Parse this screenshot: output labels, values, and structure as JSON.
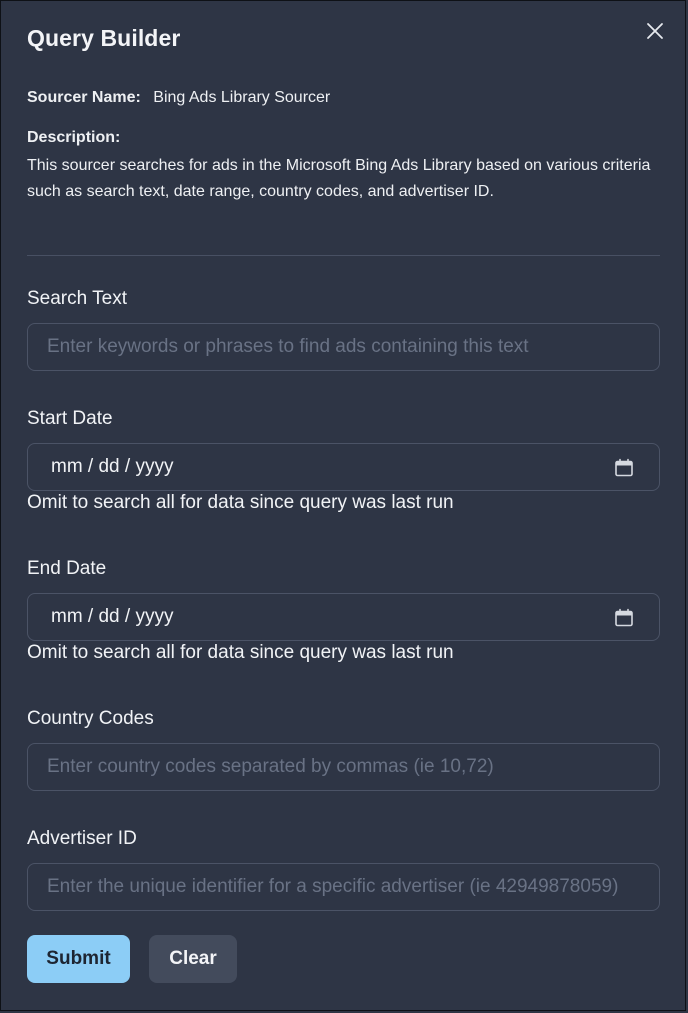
{
  "dialog": {
    "title": "Query Builder",
    "close_icon": "close-icon"
  },
  "meta": {
    "sourcer_key": "Sourcer Name:",
    "sourcer_value": "Bing Ads Library Sourcer",
    "description_key": "Description:",
    "description_value": "This sourcer searches for ads in the Microsoft Bing Ads Library based on various criteria such as search text, date range, country codes, and advertiser ID."
  },
  "fields": {
    "search_text": {
      "label": "Search Text",
      "placeholder": "Enter keywords or phrases to find ads containing this text",
      "value": ""
    },
    "start_date": {
      "label": "Start Date",
      "display": "mm / dd / yyyy",
      "hint": "Omit to search all for data since query was last run",
      "icon": "calendar-icon"
    },
    "end_date": {
      "label": "End Date",
      "display": "mm / dd / yyyy",
      "hint": "Omit to search all for data since query was last run",
      "icon": "calendar-icon"
    },
    "country_codes": {
      "label": "Country Codes",
      "placeholder": "Enter country codes separated by commas (ie 10,72)",
      "value": ""
    },
    "advertiser_id": {
      "label": "Advertiser ID",
      "placeholder": "Enter the unique identifier for a specific advertiser (ie 42949878059)",
      "value": ""
    }
  },
  "actions": {
    "submit_label": "Submit",
    "clear_label": "Clear"
  },
  "colors": {
    "background": "#2e3545",
    "border": "#4b5366",
    "submit": "#8ccdf6",
    "clear": "#434b5c",
    "placeholder": "#697285"
  }
}
